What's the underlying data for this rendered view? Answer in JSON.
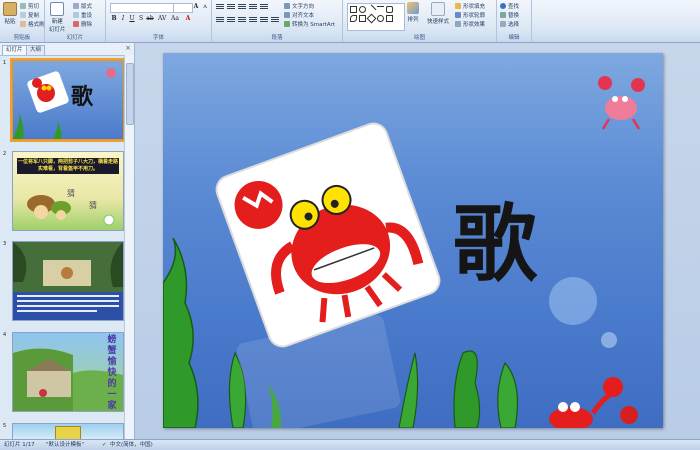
{
  "ribbon": {
    "clipboard": {
      "label": "剪贴板",
      "paste": "粘贴",
      "cut": "剪切",
      "copy": "复制",
      "format_painter": "格式刷"
    },
    "slides": {
      "label": "幻灯片",
      "new_slide": "新建\n幻灯片",
      "layout": "版式",
      "reset": "重设",
      "delete": "删除"
    },
    "font": {
      "label": "字体",
      "font_value": "",
      "size_value": ""
    },
    "paragraph": {
      "label": "段落",
      "text_direction": "文字方向",
      "align_text": "对齐文本",
      "convert_smartart": "转换为 SmartArt"
    },
    "drawing": {
      "label": "绘图",
      "arrange": "排列",
      "quick_styles": "快速样式",
      "shape_fill": "形状填充",
      "shape_outline": "形状轮廓",
      "shape_effects": "形状效果"
    },
    "editing": {
      "label": "编辑",
      "find": "查找",
      "replace": "替换",
      "select": "选择"
    }
  },
  "pane": {
    "tab_slides": "幻灯片",
    "tab_outline": "大纲",
    "close": "×",
    "thumbnails": [
      {
        "num": "1"
      },
      {
        "num": "2"
      },
      {
        "num": "3"
      },
      {
        "num": "4"
      },
      {
        "num": "5"
      }
    ],
    "thumb_texts": {
      "t1_title": "歌",
      "t2_riddle": "一位将军八只脚，两把剪子八大刀，横着走路实难看，背着盔甲不用刀。",
      "t2_guess": "猜",
      "t2_guess2": "猜",
      "t4_vertical": "螃蟹愉快的一家"
    }
  },
  "slide": {
    "title": "歌"
  },
  "status": {
    "slide_indicator": "幻灯片 1/17",
    "theme": "\"默认设计模板\"",
    "language": "中文(简体，中国)"
  },
  "colors": {
    "accent": "#e3952a",
    "slide_bg": "#5b8bd4",
    "crab_red": "#e02020"
  }
}
